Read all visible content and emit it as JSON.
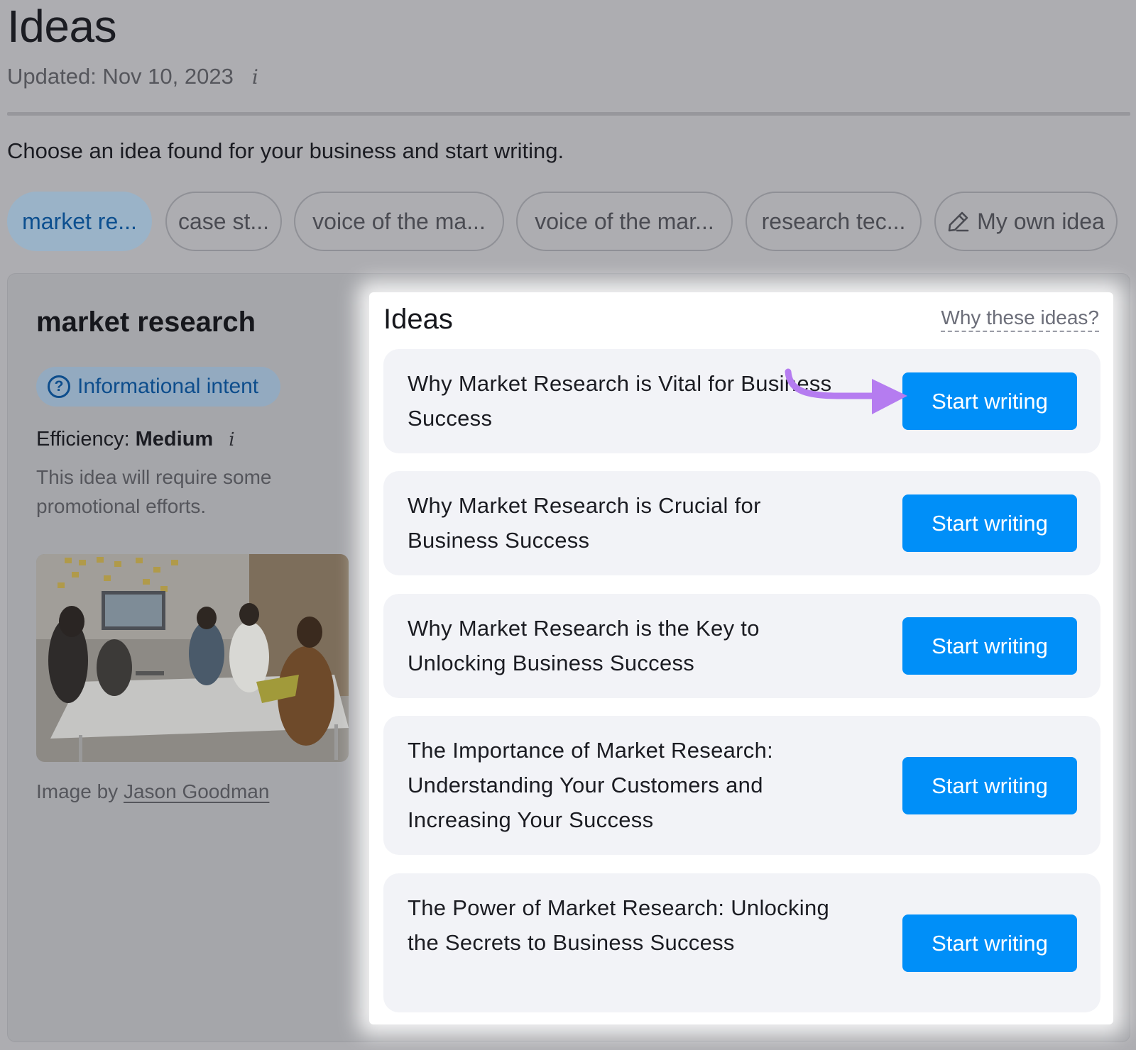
{
  "header": {
    "title": "Ideas",
    "updated": "Updated: Nov 10, 2023",
    "info_glyph": "i"
  },
  "intro": "Choose an idea found for your business and start writing.",
  "chips": [
    {
      "label": "market re...",
      "active": true
    },
    {
      "label": "case st...",
      "active": false
    },
    {
      "label": "voice of the ma...",
      "active": false
    },
    {
      "label": "voice of the mar...",
      "active": false
    },
    {
      "label": "research tec...",
      "active": false
    },
    {
      "label": "My own idea",
      "icon": "pencil-icon",
      "active": false
    }
  ],
  "topic": {
    "title": "market research",
    "intent": "Informational intent",
    "intent_icon": "question-circle-icon",
    "efficiency_label": "Efficiency:",
    "efficiency_value": "Medium",
    "efficiency_desc": "This idea will require some promotional efforts.",
    "image_credit_prefix": "Image by",
    "image_credit_author": "Jason Goodman"
  },
  "ideas": {
    "title": "Ideas",
    "why_link": "Why these ideas?",
    "items": [
      {
        "text": "Why Market Research is Vital for Business Success",
        "button": "Start writing"
      },
      {
        "text": "Why Market Research is Crucial for Business Success",
        "button": "Start writing"
      },
      {
        "text": "Why Market Research is the Key to Unlocking Business Success",
        "button": "Start writing"
      },
      {
        "text": "The Importance of Market Research: Understanding Your Customers and Increasing Your Success",
        "button": "Start writing"
      },
      {
        "text": "The Power of Market Research: Unlocking the Secrets to Business Success",
        "button": "Start writing"
      }
    ]
  },
  "colors": {
    "accent": "#008ff8",
    "annotation_arrow": "#b57cf0",
    "intent_text": "#0d4d8c"
  }
}
